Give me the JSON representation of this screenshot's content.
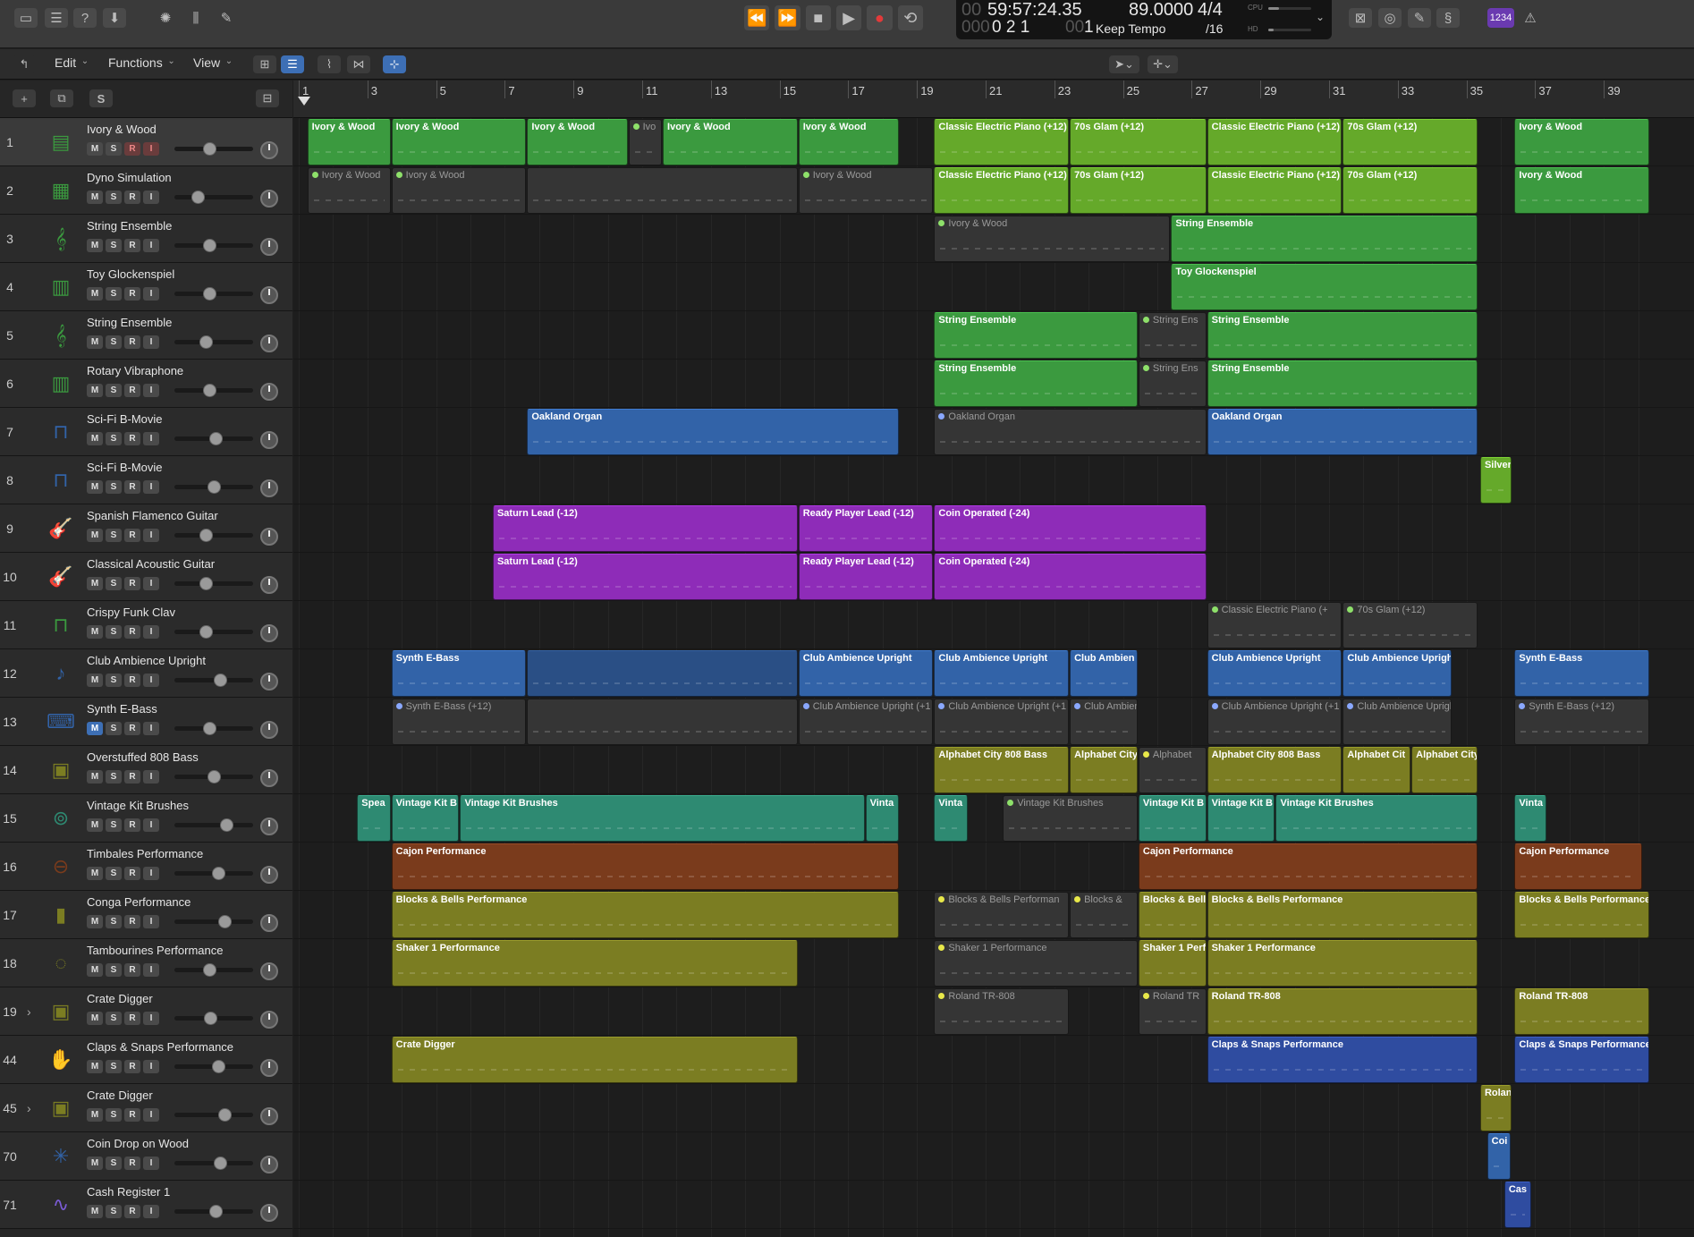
{
  "control_bar": {
    "lcd": {
      "time": "59:57:24.35",
      "time_dim": "00",
      "position": "0  2  1",
      "position_dim": "000",
      "position_last": "1",
      "position_last_dim": "00",
      "tempo": "89.0000",
      "tempo_mode": "Keep Tempo",
      "signature": "4/4",
      "division": "/16",
      "cpu_label": "CPU",
      "hd_label": "HD"
    },
    "count_in_label": "1234"
  },
  "toolbar": {
    "edit_label": "Edit",
    "functions_label": "Functions",
    "view_label": "View"
  },
  "header": {
    "s_label": "S"
  },
  "ruler": {
    "bars": [
      "1",
      "3",
      "5",
      "7",
      "9",
      "11",
      "13",
      "15",
      "17",
      "19",
      "21",
      "23",
      "25",
      "27",
      "29",
      "31",
      "33",
      "35",
      "37",
      "39"
    ]
  },
  "tracks": [
    {
      "num": "1",
      "name": "Ivory & Wood",
      "icon": "piano-icon",
      "color": "#3b9a3f",
      "selected": true,
      "r_on": true
    },
    {
      "num": "2",
      "name": "Dyno Simulation",
      "icon": "electric-piano-icon",
      "color": "#3b9a3f"
    },
    {
      "num": "3",
      "name": "String Ensemble",
      "icon": "strings-icon",
      "color": "#3b9a3f"
    },
    {
      "num": "4",
      "name": "Toy Glockenspiel",
      "icon": "glockenspiel-icon",
      "color": "#3b9a3f"
    },
    {
      "num": "5",
      "name": "String Ensemble",
      "icon": "strings-icon",
      "color": "#3b9a3f"
    },
    {
      "num": "6",
      "name": "Rotary Vibraphone",
      "icon": "vibraphone-icon",
      "color": "#3b9a3f"
    },
    {
      "num": "7",
      "name": "Sci-Fi B-Movie",
      "icon": "organ-icon",
      "color": "#3263a8"
    },
    {
      "num": "8",
      "name": "Sci-Fi B-Movie",
      "icon": "organ-icon",
      "color": "#3263a8"
    },
    {
      "num": "9",
      "name": "Spanish Flamenco Guitar",
      "icon": "guitar-icon",
      "color": "#8e2cb8"
    },
    {
      "num": "10",
      "name": "Classical Acoustic Guitar",
      "icon": "guitar-icon",
      "color": "#8e2cb8"
    },
    {
      "num": "11",
      "name": "Crispy Funk Clav",
      "icon": "clav-icon",
      "color": "#3b9a3f"
    },
    {
      "num": "12",
      "name": "Club Ambience Upright",
      "icon": "upright-bass-icon",
      "color": "#3263a8"
    },
    {
      "num": "13",
      "name": "Synth E-Bass",
      "icon": "synth-icon",
      "color": "#3263a8",
      "m_on": true
    },
    {
      "num": "14",
      "name": "Overstuffed 808 Bass",
      "icon": "drum-machine-icon",
      "color": "#7b7d22"
    },
    {
      "num": "15",
      "name": "Vintage Kit Brushes",
      "icon": "drum-kit-icon",
      "color": "#2e8a72"
    },
    {
      "num": "16",
      "name": "Timbales Performance",
      "icon": "timbales-icon",
      "color": "#7a3b1c"
    },
    {
      "num": "17",
      "name": "Conga Performance",
      "icon": "conga-icon",
      "color": "#7b7d22"
    },
    {
      "num": "18",
      "name": "Tambourines Performance",
      "icon": "tambourine-icon",
      "color": "#7b7d22"
    },
    {
      "num": "19",
      "name": "Crate Digger",
      "icon": "drum-machine-icon",
      "color": "#7b7d22",
      "stack": true
    },
    {
      "num": "44",
      "name": "Claps & Snaps Performance",
      "icon": "clap-icon",
      "color": "#2f4ca0"
    },
    {
      "num": "45",
      "name": "Crate Digger",
      "icon": "drum-machine-icon",
      "color": "#7b7d22",
      "stack": true
    },
    {
      "num": "70",
      "name": "Coin Drop on Wood",
      "icon": "burst-icon",
      "color": "#3263a8"
    },
    {
      "num": "71",
      "name": "Cash Register 1",
      "icon": "waveform-icon",
      "color": "#7b5cd6"
    }
  ],
  "track_buttons": {
    "m": "M",
    "s": "S",
    "r": "R",
    "i": "I"
  },
  "regions": [
    {
      "lane": 0,
      "bar": 0.25,
      "len": 2.45,
      "label": "Ivory & Wood",
      "color": "#3b9a3f"
    },
    {
      "lane": 0,
      "bar": 2.7,
      "len": 3.95,
      "label": "Ivory & Wood",
      "color": "#3b9a3f"
    },
    {
      "lane": 0,
      "bar": 6.65,
      "len": 2.95,
      "label": "Ivory & Wood",
      "color": "#3b9a3f"
    },
    {
      "lane": 0,
      "bar": 9.6,
      "len": 1.0,
      "label": "Ivo",
      "color": "#3b9a3f",
      "off": true
    },
    {
      "lane": 0,
      "bar": 10.6,
      "len": 3.95,
      "label": "Ivory & Wood",
      "color": "#3b9a3f"
    },
    {
      "lane": 0,
      "bar": 14.55,
      "len": 2.95,
      "label": "Ivory & Wood",
      "color": "#3b9a3f"
    },
    {
      "lane": 0,
      "bar": 18.5,
      "len": 3.95,
      "label": "Classic Electric Piano (+12)",
      "color": "#65a92a"
    },
    {
      "lane": 0,
      "bar": 22.45,
      "len": 4.0,
      "label": "70s Glam (+12)",
      "color": "#65a92a"
    },
    {
      "lane": 0,
      "bar": 26.45,
      "len": 3.95,
      "label": "Classic Electric Piano (+12)",
      "color": "#65a92a"
    },
    {
      "lane": 0,
      "bar": 30.4,
      "len": 3.95,
      "label": "70s Glam (+12)",
      "color": "#65a92a"
    },
    {
      "lane": 0,
      "bar": 35.4,
      "len": 3.95,
      "label": "Ivory & Wood",
      "color": "#3b9a3f"
    },
    {
      "lane": 1,
      "bar": 0.25,
      "len": 2.45,
      "label": "Ivory & Wood",
      "color": "#3b9a3f",
      "off": true
    },
    {
      "lane": 1,
      "bar": 2.7,
      "len": 3.95,
      "label": "Ivory & Wood",
      "color": "#3b9a3f",
      "off": true
    },
    {
      "lane": 1,
      "bar": 6.65,
      "len": 7.9,
      "label": "",
      "color": "#3b9a3f",
      "off": true
    },
    {
      "lane": 1,
      "bar": 14.55,
      "len": 3.95,
      "label": "Ivory & Wood",
      "color": "#3b9a3f",
      "off": true
    },
    {
      "lane": 1,
      "bar": 18.5,
      "len": 3.95,
      "label": "Classic Electric Piano (+12)",
      "color": "#65a92a"
    },
    {
      "lane": 1,
      "bar": 22.45,
      "len": 4.0,
      "label": "70s Glam (+12)",
      "color": "#65a92a"
    },
    {
      "lane": 1,
      "bar": 26.45,
      "len": 3.95,
      "label": "Classic Electric Piano (+12)",
      "color": "#65a92a"
    },
    {
      "lane": 1,
      "bar": 30.4,
      "len": 3.95,
      "label": "70s Glam (+12)",
      "color": "#65a92a"
    },
    {
      "lane": 1,
      "bar": 35.4,
      "len": 3.95,
      "label": "Ivory & Wood",
      "color": "#3b9a3f"
    },
    {
      "lane": 2,
      "bar": 18.5,
      "len": 6.9,
      "label": "Ivory & Wood",
      "color": "#3b9a3f",
      "off": true
    },
    {
      "lane": 2,
      "bar": 25.4,
      "len": 8.95,
      "label": "String Ensemble",
      "color": "#3b9a3f"
    },
    {
      "lane": 3,
      "bar": 25.4,
      "len": 8.95,
      "label": "Toy Glockenspiel",
      "color": "#3b9a3f"
    },
    {
      "lane": 4,
      "bar": 18.5,
      "len": 5.95,
      "label": "String Ensemble",
      "color": "#3b9a3f"
    },
    {
      "lane": 4,
      "bar": 24.45,
      "len": 2.0,
      "label": "String Ens",
      "color": "#3b9a3f",
      "off": true
    },
    {
      "lane": 4,
      "bar": 26.45,
      "len": 7.9,
      "label": "String Ensemble",
      "color": "#3b9a3f"
    },
    {
      "lane": 5,
      "bar": 18.5,
      "len": 5.95,
      "label": "String Ensemble",
      "color": "#3b9a3f"
    },
    {
      "lane": 5,
      "bar": 24.45,
      "len": 2.0,
      "label": "String Ens",
      "color": "#3b9a3f",
      "off": true
    },
    {
      "lane": 5,
      "bar": 26.45,
      "len": 7.9,
      "label": "String Ensemble",
      "color": "#3b9a3f"
    },
    {
      "lane": 6,
      "bar": 6.65,
      "len": 10.85,
      "label": "Oakland Organ",
      "color": "#3263a8"
    },
    {
      "lane": 6,
      "bar": 18.5,
      "len": 7.95,
      "label": "Oakland Organ",
      "color": "#3263a8",
      "off": true
    },
    {
      "lane": 6,
      "bar": 26.45,
      "len": 7.9,
      "label": "Oakland Organ",
      "color": "#3263a8"
    },
    {
      "lane": 7,
      "bar": 34.4,
      "len": 0.95,
      "label": "Silver",
      "color": "#65a92a"
    },
    {
      "lane": 8,
      "bar": 5.65,
      "len": 8.9,
      "label": "Saturn Lead (-12)",
      "color": "#8e2cb8"
    },
    {
      "lane": 8,
      "bar": 14.55,
      "len": 3.95,
      "label": "Ready Player Lead (-12)",
      "color": "#8e2cb8"
    },
    {
      "lane": 8,
      "bar": 18.5,
      "len": 7.95,
      "label": "Coin Operated (-24)",
      "color": "#8e2cb8"
    },
    {
      "lane": 9,
      "bar": 5.65,
      "len": 8.9,
      "label": "Saturn Lead (-12)",
      "color": "#8e2cb8"
    },
    {
      "lane": 9,
      "bar": 14.55,
      "len": 3.95,
      "label": "Ready Player Lead (-12)",
      "color": "#8e2cb8"
    },
    {
      "lane": 9,
      "bar": 18.5,
      "len": 7.95,
      "label": "Coin Operated (-24)",
      "color": "#8e2cb8"
    },
    {
      "lane": 10,
      "bar": 26.45,
      "len": 3.95,
      "label": "Classic Electric Piano (+",
      "color": "#65a92a",
      "off": true
    },
    {
      "lane": 10,
      "bar": 30.4,
      "len": 3.95,
      "label": "70s Glam (+12)",
      "color": "#65a92a",
      "off": true
    },
    {
      "lane": 11,
      "bar": 2.7,
      "len": 3.95,
      "label": "Synth E-Bass",
      "color": "#3263a8"
    },
    {
      "lane": 11,
      "bar": 6.65,
      "len": 7.9,
      "label": "",
      "color": "#2a4f85"
    },
    {
      "lane": 11,
      "bar": 14.55,
      "len": 3.95,
      "label": "Club Ambience Upright",
      "color": "#3263a8"
    },
    {
      "lane": 11,
      "bar": 18.5,
      "len": 3.95,
      "label": "Club Ambience Upright",
      "color": "#3263a8"
    },
    {
      "lane": 11,
      "bar": 22.45,
      "len": 2.0,
      "label": "Club Ambien",
      "color": "#3263a8"
    },
    {
      "lane": 11,
      "bar": 26.45,
      "len": 3.95,
      "label": "Club Ambience Upright",
      "color": "#3263a8"
    },
    {
      "lane": 11,
      "bar": 30.4,
      "len": 3.2,
      "label": "Club Ambience Uprigh",
      "color": "#3263a8"
    },
    {
      "lane": 11,
      "bar": 35.4,
      "len": 3.95,
      "label": "Synth E-Bass",
      "color": "#3263a8"
    },
    {
      "lane": 12,
      "bar": 2.7,
      "len": 3.95,
      "label": "Synth E-Bass (+12)",
      "color": "#3263a8",
      "off": true
    },
    {
      "lane": 12,
      "bar": 6.65,
      "len": 7.9,
      "label": "",
      "color": "#3263a8",
      "off": true
    },
    {
      "lane": 12,
      "bar": 14.55,
      "len": 3.95,
      "label": "Club Ambience Upright (+1",
      "color": "#3263a8",
      "off": true
    },
    {
      "lane": 12,
      "bar": 18.5,
      "len": 3.95,
      "label": "Club Ambience Upright (+1",
      "color": "#3263a8",
      "off": true
    },
    {
      "lane": 12,
      "bar": 22.45,
      "len": 2.0,
      "label": "Club Ambien",
      "color": "#3263a8",
      "off": true
    },
    {
      "lane": 12,
      "bar": 26.45,
      "len": 3.95,
      "label": "Club Ambience Upright (+1",
      "color": "#3263a8",
      "off": true
    },
    {
      "lane": 12,
      "bar": 30.4,
      "len": 3.2,
      "label": "Club Ambience Uprigh",
      "color": "#3263a8",
      "off": true
    },
    {
      "lane": 12,
      "bar": 35.4,
      "len": 3.95,
      "label": "Synth E-Bass (+12)",
      "color": "#3263a8",
      "off": true
    },
    {
      "lane": 13,
      "bar": 18.5,
      "len": 3.95,
      "label": "Alphabet City 808 Bass",
      "color": "#7b7d22"
    },
    {
      "lane": 13,
      "bar": 22.45,
      "len": 2.0,
      "label": "Alphabet City",
      "color": "#7b7d22"
    },
    {
      "lane": 13,
      "bar": 24.45,
      "len": 2.0,
      "label": "Alphabet",
      "color": "#7b7d22",
      "off": true
    },
    {
      "lane": 13,
      "bar": 26.45,
      "len": 3.95,
      "label": "Alphabet City 808 Bass",
      "color": "#7b7d22"
    },
    {
      "lane": 13,
      "bar": 30.4,
      "len": 2.0,
      "label": "Alphabet Cit",
      "color": "#7b7d22"
    },
    {
      "lane": 13,
      "bar": 32.4,
      "len": 1.95,
      "label": "Alphabet City",
      "color": "#7b7d22"
    },
    {
      "lane": 14,
      "bar": 1.7,
      "len": 1.0,
      "label": "Spea",
      "color": "#2e8a72"
    },
    {
      "lane": 14,
      "bar": 2.7,
      "len": 2.0,
      "label": "Vintage Kit B",
      "color": "#2e8a72"
    },
    {
      "lane": 14,
      "bar": 4.7,
      "len": 11.8,
      "label": "Vintage Kit Brushes",
      "color": "#2e8a72"
    },
    {
      "lane": 14,
      "bar": 16.5,
      "len": 1.0,
      "label": "Vinta",
      "color": "#2e8a72"
    },
    {
      "lane": 14,
      "bar": 18.5,
      "len": 1.0,
      "label": "Vinta",
      "color": "#2e8a72"
    },
    {
      "lane": 14,
      "bar": 20.5,
      "len": 3.95,
      "label": "Vintage Kit Brushes",
      "color": "#2e8a72",
      "off": true
    },
    {
      "lane": 14,
      "bar": 24.45,
      "len": 2.0,
      "label": "Vintage Kit B",
      "color": "#2e8a72"
    },
    {
      "lane": 14,
      "bar": 26.45,
      "len": 2.0,
      "label": "Vintage Kit B",
      "color": "#2e8a72"
    },
    {
      "lane": 14,
      "bar": 28.45,
      "len": 5.9,
      "label": "Vintage Kit Brushes",
      "color": "#2e8a72"
    },
    {
      "lane": 14,
      "bar": 35.4,
      "len": 0.95,
      "label": "Vinta",
      "color": "#2e8a72"
    },
    {
      "lane": 15,
      "bar": 2.7,
      "len": 14.8,
      "label": "Cajon Performance",
      "color": "#7a3b1c"
    },
    {
      "lane": 15,
      "bar": 24.45,
      "len": 9.9,
      "label": "Cajon Performance",
      "color": "#7a3b1c"
    },
    {
      "lane": 15,
      "bar": 35.4,
      "len": 3.75,
      "label": "Cajon Performance",
      "color": "#7a3b1c"
    },
    {
      "lane": 16,
      "bar": 2.7,
      "len": 14.8,
      "label": "Blocks & Bells Performance",
      "color": "#7b7d22"
    },
    {
      "lane": 16,
      "bar": 18.5,
      "len": 3.95,
      "label": "Blocks & Bells Performan",
      "color": "#7b7d22",
      "off": true
    },
    {
      "lane": 16,
      "bar": 22.45,
      "len": 2.0,
      "label": "Blocks &",
      "color": "#7b7d22",
      "off": true
    },
    {
      "lane": 16,
      "bar": 24.45,
      "len": 2.0,
      "label": "Blocks & Bell",
      "color": "#7b7d22"
    },
    {
      "lane": 16,
      "bar": 26.45,
      "len": 7.9,
      "label": "Blocks & Bells Performance",
      "color": "#7b7d22"
    },
    {
      "lane": 16,
      "bar": 35.4,
      "len": 3.95,
      "label": "Blocks & Bells Performance",
      "color": "#7b7d22"
    },
    {
      "lane": 17,
      "bar": 2.7,
      "len": 11.85,
      "label": "Shaker 1 Performance",
      "color": "#7b7d22"
    },
    {
      "lane": 17,
      "bar": 18.5,
      "len": 5.95,
      "label": "Shaker 1 Performance",
      "color": "#7b7d22",
      "off": true
    },
    {
      "lane": 17,
      "bar": 24.45,
      "len": 2.0,
      "label": "Shaker 1 Perf",
      "color": "#7b7d22"
    },
    {
      "lane": 17,
      "bar": 26.45,
      "len": 7.9,
      "label": "Shaker 1 Performance",
      "color": "#7b7d22"
    },
    {
      "lane": 18,
      "bar": 18.5,
      "len": 3.95,
      "label": "Roland TR-808",
      "color": "#7b7d22",
      "off": true
    },
    {
      "lane": 18,
      "bar": 24.45,
      "len": 2.0,
      "label": "Roland TR",
      "color": "#7b7d22",
      "off": true
    },
    {
      "lane": 18,
      "bar": 26.45,
      "len": 7.9,
      "label": "Roland TR-808",
      "color": "#7b7d22"
    },
    {
      "lane": 18,
      "bar": 35.4,
      "len": 3.95,
      "label": "Roland TR-808",
      "color": "#7b7d22"
    },
    {
      "lane": 19,
      "bar": 2.7,
      "len": 11.85,
      "label": "Crate Digger",
      "color": "#7b7d22"
    },
    {
      "lane": 19,
      "bar": 26.45,
      "len": 7.9,
      "label": "Claps & Snaps Performance",
      "color": "#2f4ca0"
    },
    {
      "lane": 19,
      "bar": 35.4,
      "len": 3.95,
      "label": "Claps & Snaps Performance",
      "color": "#2f4ca0"
    },
    {
      "lane": 20,
      "bar": 34.4,
      "len": 0.95,
      "label": "Rolan",
      "color": "#7b7d22"
    },
    {
      "lane": 21,
      "bar": 34.6,
      "len": 0.7,
      "label": "Coi",
      "color": "#3263a8"
    },
    {
      "lane": 22,
      "bar": 35.1,
      "len": 0.8,
      "label": "Cas",
      "color": "#2f4ca0"
    }
  ]
}
